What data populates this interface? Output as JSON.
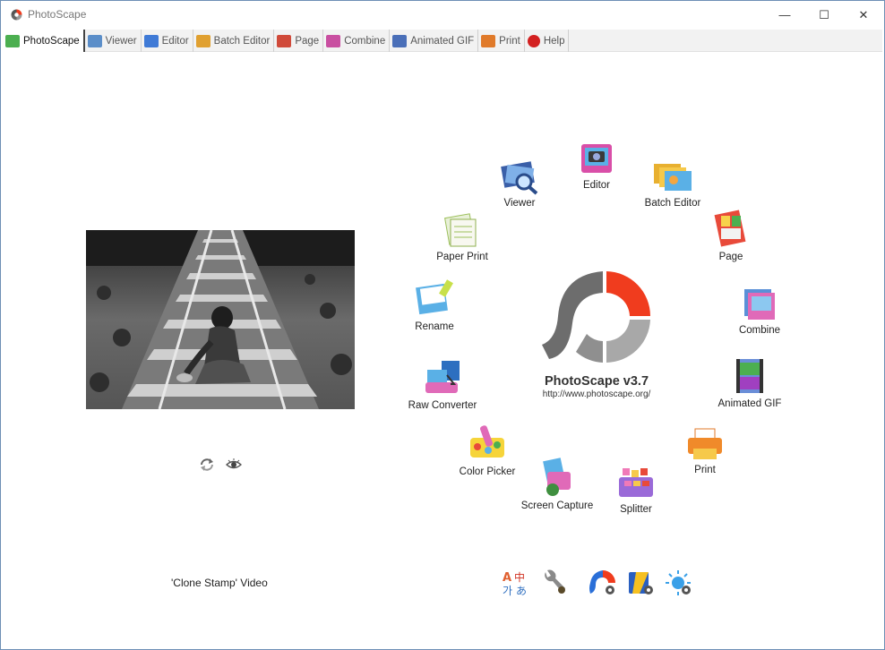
{
  "window": {
    "title": "PhotoScape",
    "controls": {
      "minimize": "—",
      "maximize": "☐",
      "close": "✕"
    }
  },
  "tabs": [
    {
      "label": "PhotoScape",
      "color": "#4caf50",
      "active": true
    },
    {
      "label": "Viewer",
      "color": "#5b8ec9"
    },
    {
      "label": "Editor",
      "color": "#3f7ad6"
    },
    {
      "label": "Batch Editor",
      "color": "#e0a030"
    },
    {
      "label": "Page",
      "color": "#d04a3a"
    },
    {
      "label": "Combine",
      "color": "#c94fa1"
    },
    {
      "label": "Animated GIF",
      "color": "#4a6fb8"
    },
    {
      "label": "Print",
      "color": "#e07a2a"
    },
    {
      "label": "Help",
      "color": "#d32020"
    }
  ],
  "left_panel": {
    "video_label": "'Clone Stamp' Video",
    "icons": [
      "refresh-icon",
      "eye-icon"
    ]
  },
  "center": {
    "app_title": "PhotoScape v3.7",
    "app_url": "http://www.photoscape.org/"
  },
  "features": {
    "viewer": "Viewer",
    "editor": "Editor",
    "batch_editor": "Batch Editor",
    "page": "Page",
    "paper_print": "Paper Print",
    "combine": "Combine",
    "rename": "Rename",
    "animated_gif": "Animated GIF",
    "raw_converter": "Raw Converter",
    "print": "Print",
    "color_picker": "Color Picker",
    "screen_capture": "Screen Capture",
    "splitter": "Splitter"
  },
  "bottom_tools": [
    "language-icon",
    "wrench-icon",
    "photoscape-update-icon",
    "photoscape-x-icon",
    "brightness-icon"
  ],
  "language_glyphs": {
    "a": "A",
    "zh": "中",
    "ko": "가",
    "ja": "あ"
  },
  "colors": {
    "accent_red": "#f03c1e",
    "logo_gray": "#777777",
    "logo_light": "#a8a8a8"
  }
}
